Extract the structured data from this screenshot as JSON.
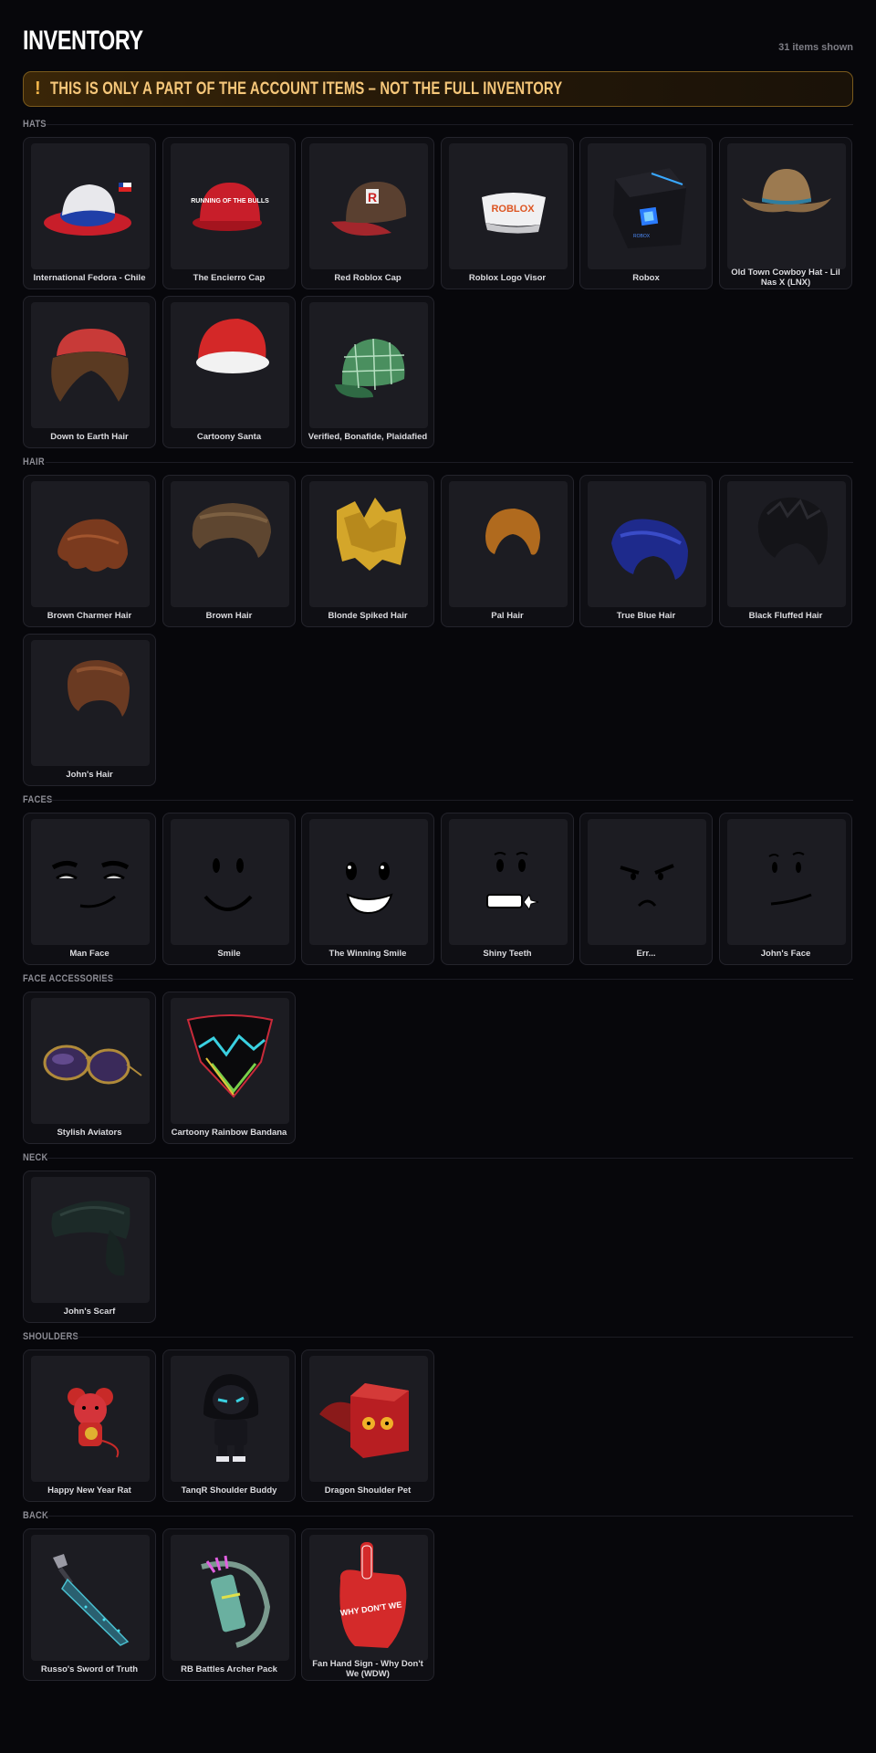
{
  "header": {
    "title": "INVENTORY",
    "count": "31 items shown"
  },
  "warning": {
    "icon": "!",
    "text": "THIS IS ONLY A PART OF THE ACCOUNT ITEMS – NOT THE FULL INVENTORY"
  },
  "sections": [
    {
      "label": "HATS",
      "items": [
        "International Fedora - Chile",
        "The Encierro Cap",
        "Red Roblox Cap",
        "Roblox Logo Visor",
        "Robox",
        "Old Town Cowboy Hat - Lil Nas X (LNX)",
        "Down to Earth Hair",
        "Cartoony Santa",
        "Verified, Bonafide, Plaidafied"
      ]
    },
    {
      "label": "HAIR",
      "items": [
        "Brown Charmer Hair",
        "Brown Hair",
        "Blonde Spiked Hair",
        "Pal Hair",
        "True Blue Hair",
        "Black Fluffed Hair",
        "John's Hair"
      ]
    },
    {
      "label": "FACES",
      "items": [
        "Man Face",
        "Smile",
        "The Winning Smile",
        "Shiny Teeth",
        "Err...",
        "John's Face"
      ]
    },
    {
      "label": "FACE ACCESSORIES",
      "items": [
        "Stylish Aviators",
        "Cartoony Rainbow Bandana"
      ]
    },
    {
      "label": "NECK",
      "items": [
        "John's Scarf"
      ]
    },
    {
      "label": "SHOULDERS",
      "items": [
        "Happy New Year Rat",
        "TanqR Shoulder Buddy",
        "Dragon Shoulder Pet"
      ]
    },
    {
      "label": "BACK",
      "items": [
        "Russo's Sword of Truth",
        "RB Battles Archer Pack",
        "Fan Hand Sign - Why Don't We (WDW)"
      ]
    }
  ],
  "thumb_text": {
    "encierro_cap": "RUNNING OF THE BULLS",
    "red_cap_logo": "R",
    "visor_logo": "ROBLOX",
    "robox_label": "ROBOX",
    "fan_sign": "WHY DON'T WE"
  }
}
